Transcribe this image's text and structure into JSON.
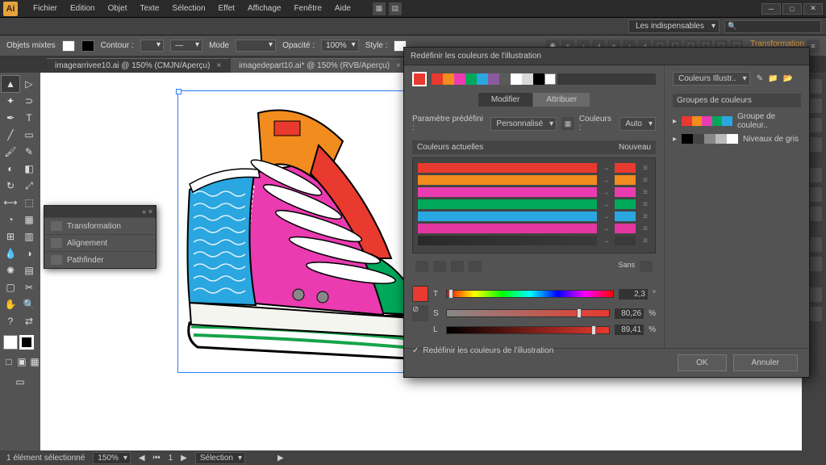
{
  "app": {
    "logo": "Ai"
  },
  "menu": [
    "Fichier",
    "Edition",
    "Objet",
    "Texte",
    "Sélection",
    "Effet",
    "Affichage",
    "Fenêtre",
    "Aide"
  ],
  "essentials": "Les indispensables",
  "ctrl": {
    "objets": "Objets mixtes",
    "contour": "Contour :",
    "mode": "Mode",
    "opacite": "Opacité :",
    "opacite_val": "100%",
    "style": "Style :",
    "transform": "Transformation"
  },
  "tabs": [
    {
      "label": "imagearrivee10.ai @ 150% (CMJN/Aperçu)",
      "active": false
    },
    {
      "label": "imagedepart10.ai* @ 150% (RVB/Aperçu)",
      "active": true
    }
  ],
  "float_panel": {
    "items": [
      "Transformation",
      "Alignement",
      "Pathfinder"
    ]
  },
  "dialog": {
    "title": "Redéfinir les couleurs de l'illustration",
    "tabs": {
      "modifier": "Modifier",
      "attribuer": "Attribuer"
    },
    "param_label": "Paramètre prédéfini :",
    "param_val": "Personnalisé",
    "couleurs_label": "Couleurs :",
    "couleurs_val": "Auto",
    "actuelles": "Couleurs actuelles",
    "nouveau": "Nouveau",
    "swatches": [
      "#e83a2e",
      "#f28c1e",
      "#ea3bb0",
      "#00a85a",
      "#2aa6e0",
      "#8a5a9e",
      "#5a5a5a",
      "#ffffff",
      "#d9d9d9",
      "#000000",
      "#ffffff"
    ],
    "bars": [
      {
        "c": "#e83a2e"
      },
      {
        "c": "#f28c1e"
      },
      {
        "c": "#ea3bb0"
      },
      {
        "c": "#00a85a"
      },
      {
        "c": "#2aa6e0"
      },
      {
        "c": "#e236a1"
      }
    ],
    "sans": "Sans",
    "tsl": {
      "color": "#e83a2e",
      "t": {
        "lbl": "T",
        "val": "2,3",
        "pct": "°"
      },
      "s": {
        "lbl": "S",
        "val": "80,26",
        "pct": "%"
      },
      "l": {
        "lbl": "L",
        "val": "89,41",
        "pct": "%"
      }
    },
    "redef": "Redéfinir les couleurs de l'illustration",
    "ok": "OK",
    "annuler": "Annuler",
    "side": {
      "dd": "Couleurs Illustr..",
      "hdr": "Groupes de couleurs",
      "g1": "Groupe de couleur..",
      "g2": "Niveaux de gris"
    }
  },
  "status": {
    "elem": "1 élément sélectionné",
    "zoom": "150%",
    "sel": "Sélection"
  }
}
